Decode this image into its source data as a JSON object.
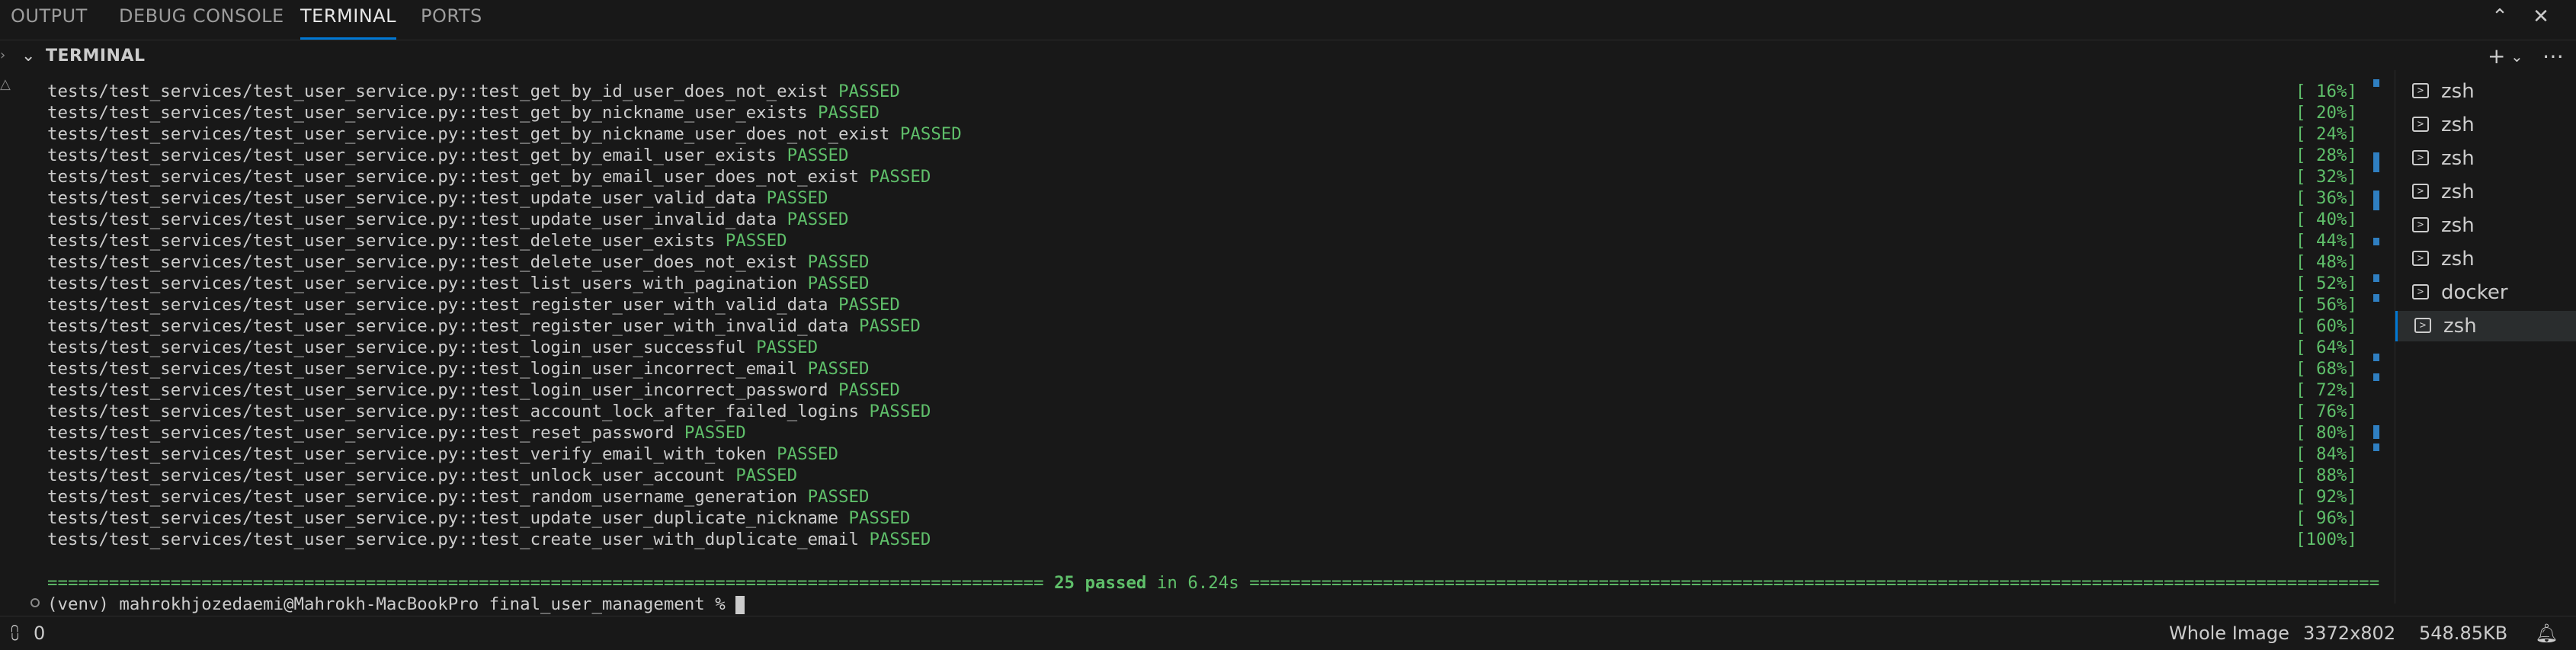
{
  "tabs": [
    "OUTPUT",
    "DEBUG CONSOLE",
    "TERMINAL",
    "PORTS"
  ],
  "active_tab": "TERMINAL",
  "panel_title": "TERMINAL",
  "test_prefix": "tests/test_services/test_user_service.py::",
  "lines": [
    {
      "name": "test_get_by_id_user_does_not_exist",
      "result": "PASSED",
      "pct": "[ 16%]"
    },
    {
      "name": "test_get_by_nickname_user_exists",
      "result": "PASSED",
      "pct": "[ 20%]"
    },
    {
      "name": "test_get_by_nickname_user_does_not_exist",
      "result": "PASSED",
      "pct": "[ 24%]"
    },
    {
      "name": "test_get_by_email_user_exists",
      "result": "PASSED",
      "pct": "[ 28%]"
    },
    {
      "name": "test_get_by_email_user_does_not_exist",
      "result": "PASSED",
      "pct": "[ 32%]"
    },
    {
      "name": "test_update_user_valid_data",
      "result": "PASSED",
      "pct": "[ 36%]"
    },
    {
      "name": "test_update_user_invalid_data",
      "result": "PASSED",
      "pct": "[ 40%]"
    },
    {
      "name": "test_delete_user_exists",
      "result": "PASSED",
      "pct": "[ 44%]"
    },
    {
      "name": "test_delete_user_does_not_exist",
      "result": "PASSED",
      "pct": "[ 48%]"
    },
    {
      "name": "test_list_users_with_pagination",
      "result": "PASSED",
      "pct": "[ 52%]"
    },
    {
      "name": "test_register_user_with_valid_data",
      "result": "PASSED",
      "pct": "[ 56%]"
    },
    {
      "name": "test_register_user_with_invalid_data",
      "result": "PASSED",
      "pct": "[ 60%]"
    },
    {
      "name": "test_login_user_successful",
      "result": "PASSED",
      "pct": "[ 64%]"
    },
    {
      "name": "test_login_user_incorrect_email",
      "result": "PASSED",
      "pct": "[ 68%]"
    },
    {
      "name": "test_login_user_incorrect_password",
      "result": "PASSED",
      "pct": "[ 72%]"
    },
    {
      "name": "test_account_lock_after_failed_logins",
      "result": "PASSED",
      "pct": "[ 76%]"
    },
    {
      "name": "test_reset_password",
      "result": "PASSED",
      "pct": "[ 80%]"
    },
    {
      "name": "test_verify_email_with_token",
      "result": "PASSED",
      "pct": "[ 84%]"
    },
    {
      "name": "test_unlock_user_account",
      "result": "PASSED",
      "pct": "[ 88%]"
    },
    {
      "name": "test_random_username_generation",
      "result": "PASSED",
      "pct": "[ 92%]"
    },
    {
      "name": "test_update_user_duplicate_nickname",
      "result": "PASSED",
      "pct": "[ 96%]"
    },
    {
      "name": "test_create_user_with_duplicate_email",
      "result": "PASSED",
      "pct": "[100%]"
    }
  ],
  "summary": {
    "passed": "25 passed",
    "time": "in 6.24s"
  },
  "prompt": "(venv) mahrokhjozedaemi@Mahrokh-MacBookPro final_user_management % ",
  "terminals": [
    "zsh",
    "zsh",
    "zsh",
    "zsh",
    "zsh",
    "zsh",
    "docker",
    "zsh"
  ],
  "active_terminal_index": 7,
  "status_bar": {
    "ports": "0",
    "image_mode": "Whole Image",
    "dimensions": "3372x802",
    "file_size": "548.85KB"
  },
  "colors": {
    "passed": "#5fbf6a",
    "accent": "#0078d4",
    "scroll_mark": "#2f7fc1"
  },
  "icons": [
    "chevron-up-icon",
    "close-icon",
    "chevron-down-icon",
    "plus-icon",
    "more-icon",
    "terminal-icon",
    "broadcast-icon",
    "bell-icon"
  ]
}
